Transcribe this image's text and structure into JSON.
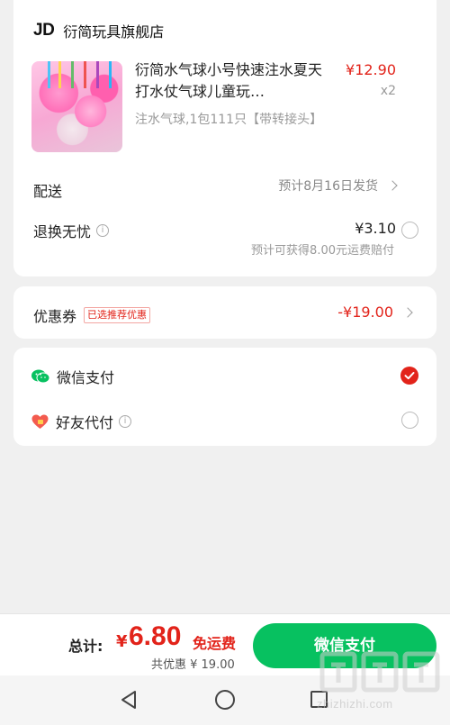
{
  "store": {
    "logo": "JD",
    "name": "衍简玩具旗舰店"
  },
  "product": {
    "title": "衍简水气球小号快速注水夏天打水仗气球儿童玩…",
    "price": "¥12.90",
    "quantity": "x2",
    "spec": "注水气球,1包111只【带转接头】",
    "image_icon": "water-balloons-image"
  },
  "delivery": {
    "label": "配送",
    "value": "预计8月16日发货"
  },
  "return_service": {
    "label": "退换无忧",
    "price": "¥3.10",
    "note": "预计可获得8.00元运费赔付",
    "selected": false
  },
  "coupon": {
    "label": "优惠券",
    "badge": "已选推荐优惠",
    "value": "-¥19.00"
  },
  "payment": {
    "options": [
      {
        "label": "微信支付",
        "icon": "wechat-icon",
        "selected": true
      },
      {
        "label": "好友代付",
        "icon": "friend-pay-icon",
        "selected": false
      }
    ]
  },
  "bottom": {
    "total_label": "总计:",
    "currency": "¥",
    "total_amount": "6.80",
    "shipping": "免运费",
    "discount": "共优惠 ¥ 19.00",
    "pay_button": "微信支付"
  },
  "watermark": "zhizhizhi.com",
  "colors": {
    "accent_red": "#e2231a",
    "wechat_green": "#07c160"
  }
}
